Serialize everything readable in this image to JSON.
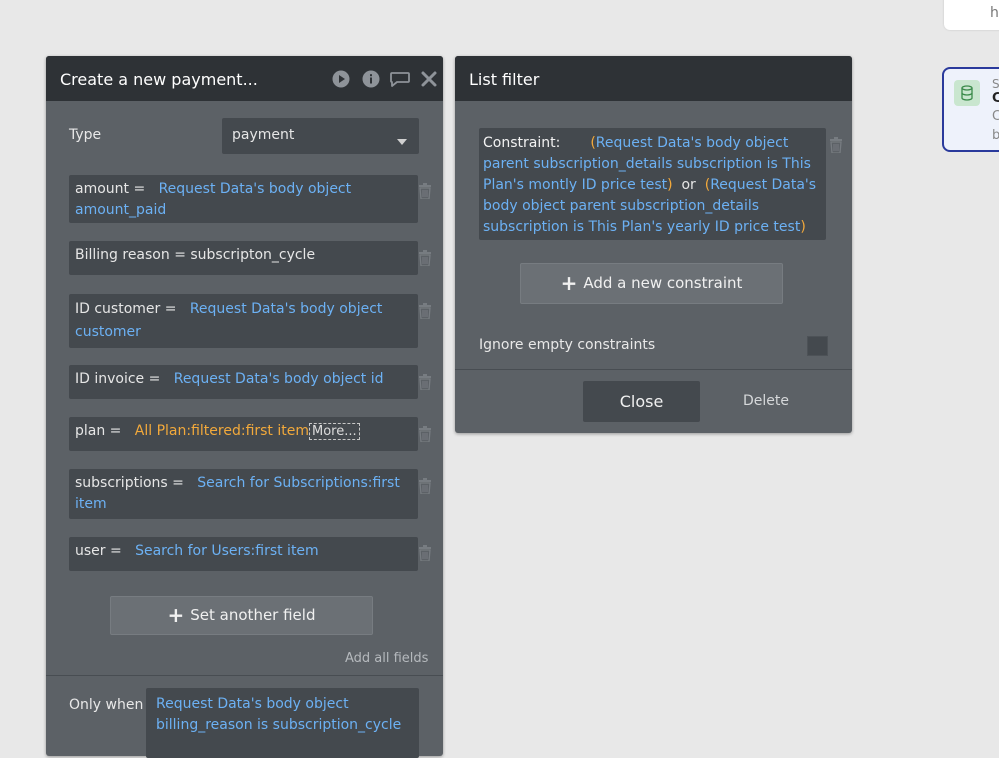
{
  "top_right_card": {
    "text": "h"
  },
  "right_node": {
    "line1": "S",
    "line2": "C",
    "line3": "C",
    "line4": "b"
  },
  "payment_panel": {
    "title": "Create a new payment...",
    "type_label": "Type",
    "type_value": "payment",
    "fields": [
      {
        "name": "amount =",
        "value": "Request Data's body object amount_paid"
      },
      {
        "name": "Billing reason = subscripton_cycle"
      },
      {
        "name": "ID customer =",
        "value": "Request Data's body object customer"
      },
      {
        "name": "ID invoice =",
        "value": "Request Data's body object id"
      },
      {
        "name": "plan =",
        "value": "All Plan:filtered:first item",
        "more": "More..."
      },
      {
        "name": "subscriptions =",
        "value": "Search for Subscriptions:first item"
      },
      {
        "name": "user =",
        "value": "Search for Users:first item"
      }
    ],
    "set_another_field": "Set another field",
    "add_all_fields": "Add all fields",
    "only_when_label": "Only when",
    "only_when_value": "Request Data's body object billing_reason is subscription_cycle"
  },
  "list_filter": {
    "title": "List filter",
    "constraint_label": "Constraint:",
    "constraint_part1": "Request Data's body object parent subscription_details subscription is This Plan's montly ID price test",
    "or_text": "or",
    "constraint_part2": "Request Data's body object parent subscription_details subscription is This Plan's yearly ID price test",
    "brace_open": "(",
    "brace_close": ")",
    "add_constraint": "Add a new constraint",
    "ignore_empty": "Ignore empty constraints",
    "close_label": "Close",
    "delete_label": "Delete"
  },
  "colors": {
    "dynamic_blue": "#6cb1f4",
    "orange": "#f2a93b",
    "panel_bg": "#5c6166",
    "header_bg": "#2e3236"
  }
}
